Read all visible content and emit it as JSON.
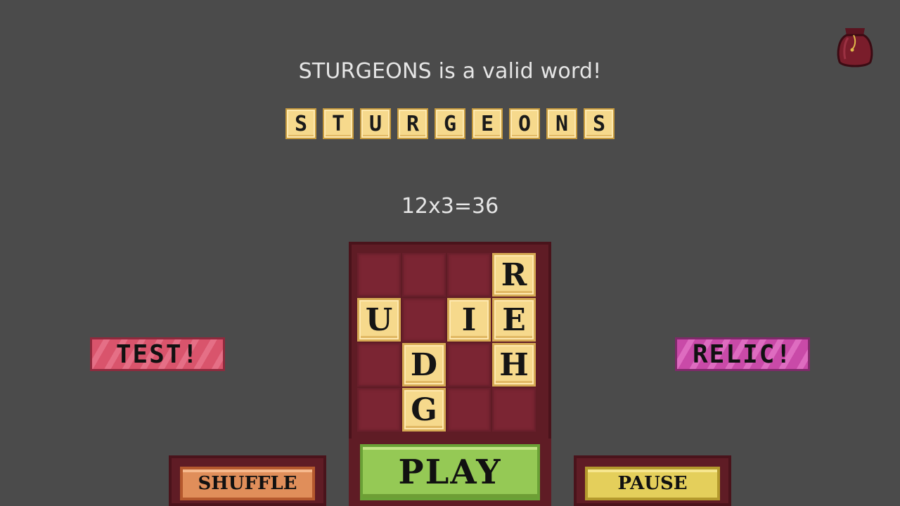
{
  "message": "STURGEONS is a valid word!",
  "word_tiles": [
    "S",
    "T",
    "U",
    "R",
    "G",
    "E",
    "O",
    "N",
    "S"
  ],
  "score_text": "12x3=36",
  "board": {
    "rows": 4,
    "cols": 4,
    "tiles": [
      {
        "letter": "R",
        "row": 0,
        "col": 3
      },
      {
        "letter": "U",
        "row": 1,
        "col": 0
      },
      {
        "letter": "I",
        "row": 1,
        "col": 2
      },
      {
        "letter": "E",
        "row": 1,
        "col": 3
      },
      {
        "letter": "D",
        "row": 2,
        "col": 1
      },
      {
        "letter": "H",
        "row": 2,
        "col": 3
      },
      {
        "letter": "G",
        "row": 3,
        "col": 1
      }
    ]
  },
  "buttons": {
    "test": "TEST!",
    "relic": "RELIC!",
    "play": "PLAY",
    "shuffle": "SHUFFLE",
    "pause": "PAUSE"
  },
  "icons": {
    "bag": "bag-icon"
  },
  "colors": {
    "background": "#4b4b4b",
    "tile": "#f6d98c",
    "board": "#7b2533",
    "play": "#95c955",
    "test": "#d9546c",
    "relic": "#c94aa8",
    "shuffle": "#e08e5a",
    "pause": "#e4cf5b"
  }
}
